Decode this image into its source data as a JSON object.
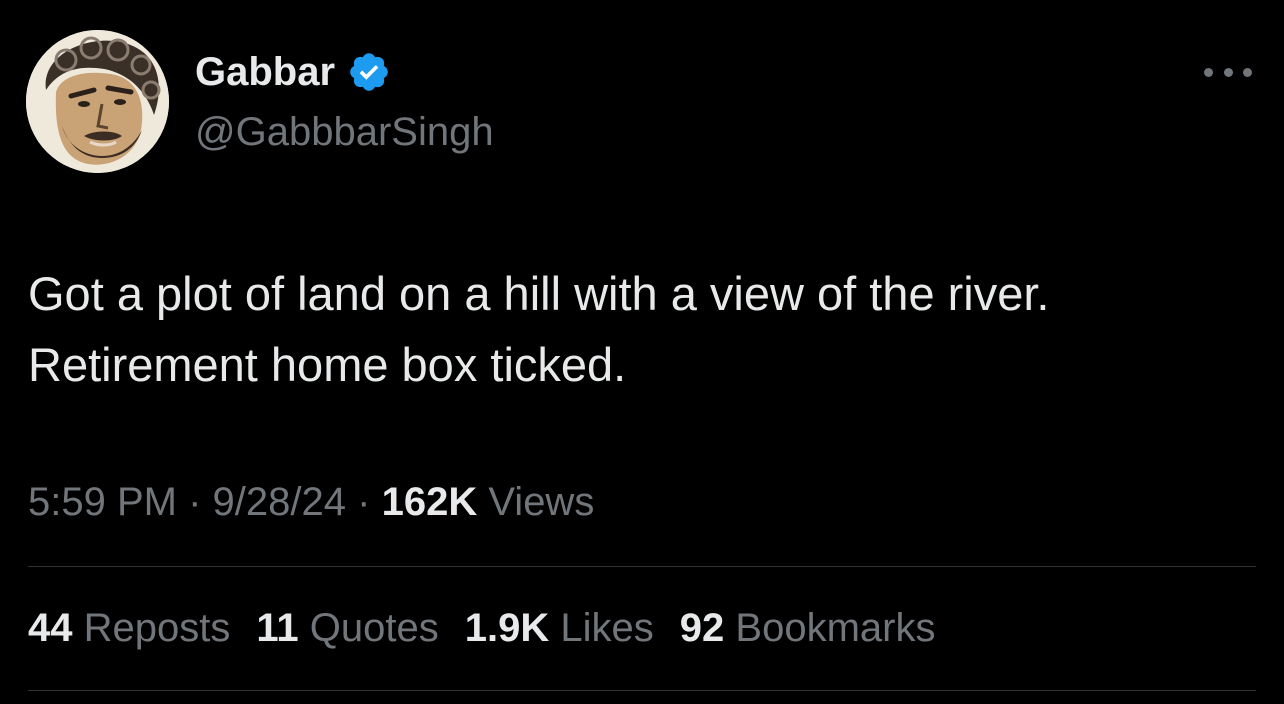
{
  "author": {
    "display_name": "Gabbar",
    "handle": "@GabbbarSingh",
    "verified_icon": "verified-badge-icon",
    "verified_color": "#1d9bf0"
  },
  "tweet": {
    "lines": [
      "Got a plot of land on a hill with a view of the river.",
      "Retirement home box ticked."
    ]
  },
  "meta": {
    "time": "5:59 PM",
    "separator": "·",
    "date": "9/28/24",
    "views_count": "162K",
    "views_label": "Views"
  },
  "stats": [
    {
      "count": "44",
      "label": "Reposts"
    },
    {
      "count": "11",
      "label": "Quotes"
    },
    {
      "count": "1.9K",
      "label": "Likes"
    },
    {
      "count": "92",
      "label": "Bookmarks"
    }
  ],
  "colors": {
    "background": "#000000",
    "primary_text": "#e7e9ea",
    "secondary_text": "#71767b",
    "divider": "#2f3336"
  },
  "icons": {
    "more": "more-options-icon",
    "avatar": "avatar-caricature"
  }
}
